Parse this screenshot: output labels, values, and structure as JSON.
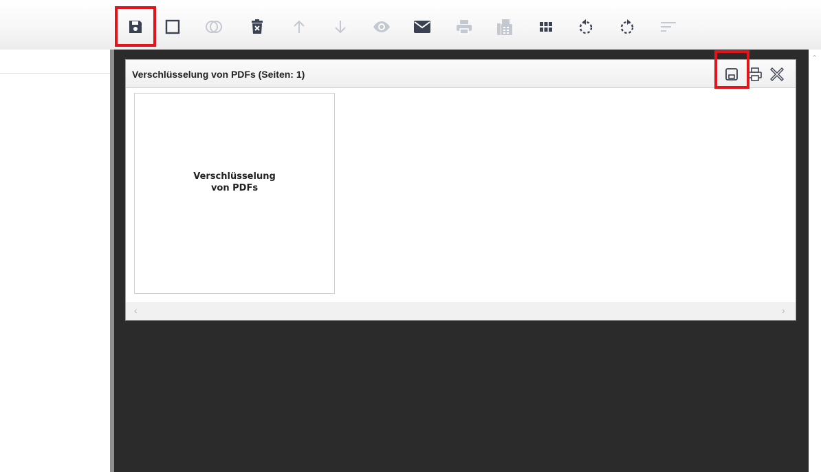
{
  "toolbar": {
    "buttons": [
      {
        "name": "save",
        "icon": "save-icon",
        "enabled": true
      },
      {
        "name": "select-page",
        "icon": "square-icon",
        "enabled": true
      },
      {
        "name": "merge",
        "icon": "merge-circles-icon",
        "enabled": false
      },
      {
        "name": "delete",
        "icon": "trash-icon",
        "enabled": true
      },
      {
        "name": "move-up",
        "icon": "arrow-up-icon",
        "enabled": false
      },
      {
        "name": "move-down",
        "icon": "arrow-down-icon",
        "enabled": false
      },
      {
        "name": "preview",
        "icon": "eye-icon",
        "enabled": false
      },
      {
        "name": "email",
        "icon": "envelope-icon",
        "enabled": true
      },
      {
        "name": "print",
        "icon": "printer-icon",
        "enabled": false
      },
      {
        "name": "fax",
        "icon": "fax-icon",
        "enabled": false
      },
      {
        "name": "grid-view",
        "icon": "grid-icon",
        "enabled": true
      },
      {
        "name": "rotate-left",
        "icon": "rotate-left-icon",
        "enabled": true
      },
      {
        "name": "rotate-right",
        "icon": "rotate-right-icon",
        "enabled": true
      },
      {
        "name": "sort",
        "icon": "sort-lines-icon",
        "enabled": false
      }
    ]
  },
  "document": {
    "title": "Verschlüsselung von PDFs (Seiten: 1)",
    "header_icons": [
      "save-icon",
      "printer-icon",
      "close-icon"
    ],
    "page_text_line1": "Verschlüsselung",
    "page_text_line2": "von PDFs"
  },
  "colors": {
    "highlight": "#e3141b",
    "icon_active": "#3a4150",
    "icon_disabled": "#c4c8d0",
    "viewer_background": "#2b2b2b"
  }
}
